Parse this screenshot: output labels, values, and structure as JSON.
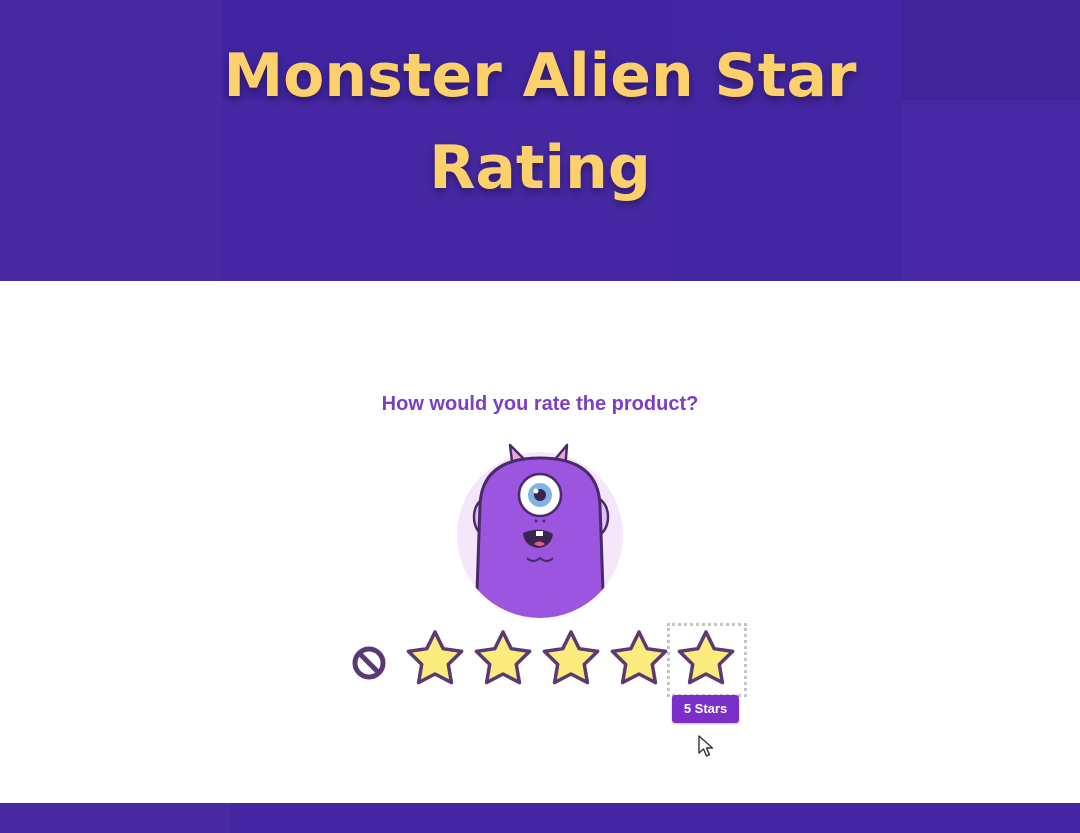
{
  "header": {
    "title": "Monster Alien Star Rating"
  },
  "question": "How would you rate the product?",
  "rating": {
    "value": 5,
    "max": 5,
    "tooltip": "5 Stars",
    "star_fill": "#fbec7d",
    "star_stroke": "#5b3a73"
  },
  "colors": {
    "header_bg": "#4527a0",
    "title": "#fcd06b",
    "accent": "#7b2fc9",
    "monster_body": "#9b55de"
  },
  "icons": [
    "monster-avatar",
    "clear-rating-icon",
    "star-icon",
    "mouse-cursor-icon"
  ]
}
